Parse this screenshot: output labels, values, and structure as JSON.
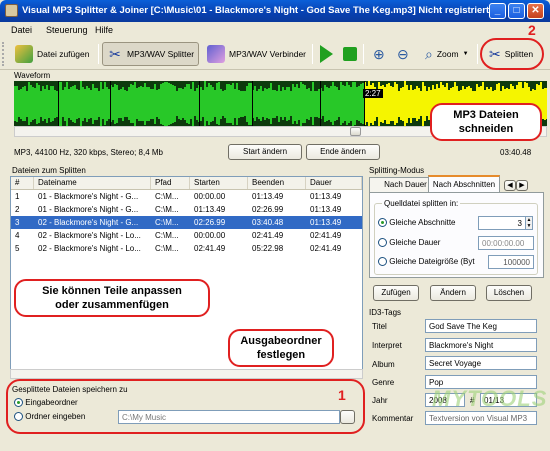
{
  "title": "Visual MP3 Splitter & Joiner [C:\\Music\\01 - Blackmore's Night - God Save The Keg.mp3] Nicht registriert",
  "menu": [
    "Datei",
    "Steuerung",
    "Hilfe"
  ],
  "toolbar": {
    "add_file": "Datei zufügen",
    "splitter": "MP3/WAV Splitter",
    "joiner": "MP3/WAV Verbinder",
    "zoom": "Zoom",
    "split": "Splitten"
  },
  "waveform": {
    "label": "Waveform",
    "marker_time": "2:27",
    "info": "MP3, 44100 Hz, 320 kbps, Stereo; 8,4 Mb",
    "start_button": "Start ändern",
    "end_button": "Ende ändern",
    "total_time": "03:40.48",
    "scroll_value": "0"
  },
  "files": {
    "label": "Dateien zum Splitten",
    "columns": [
      "#",
      "Dateiname",
      "Pfad",
      "Starten",
      "Beenden",
      "Dauer"
    ],
    "rows": [
      [
        "1",
        "01 - Blackmore's Night - G...",
        "C:\\M...",
        "00:00.00",
        "01:13.49",
        "01:13.49"
      ],
      [
        "2",
        "01 - Blackmore's Night - G...",
        "C:\\M...",
        "01:13.49",
        "02:26.99",
        "01:13.49"
      ],
      [
        "3",
        "02 - Blackmore's Night - G...",
        "C:\\M...",
        "02:26.99",
        "03:40.48",
        "01:13.49"
      ],
      [
        "4",
        "02 - Blackmore's Night - Lo...",
        "C:\\M...",
        "00:00.00",
        "02:41.49",
        "02:41.49"
      ],
      [
        "5",
        "02 - Blackmore's Night - Lo...",
        "C:\\M...",
        "02:41.49",
        "05:22.98",
        "02:41.49"
      ]
    ],
    "selected_index": 2
  },
  "splitting": {
    "label": "Splitting-Modus",
    "tabs": [
      "Nach Dauer",
      "Nach Abschnitten"
    ],
    "group_label": "Quelldatei splitten in:",
    "options": [
      "Gleiche Abschnitte",
      "Gleiche Dauer",
      "Gleiche Dateigröße (Byt"
    ],
    "equal_parts": "3",
    "equal_duration": "00:00:00.00",
    "equal_size": "100000",
    "add": "Zufügen",
    "change": "Ändern",
    "delete": "Löschen"
  },
  "id3": {
    "label": "ID3-Tags",
    "title_label": "Titel",
    "title": "God Save The Keg",
    "artist_label": "Interpret",
    "artist": "Blackmore's Night",
    "album_label": "Album",
    "album": "Secret Voyage",
    "genre_label": "Genre",
    "genre": "Pop",
    "year_label": "Jahr",
    "year": "2008",
    "track_label": "#",
    "track": "01/13",
    "comment_label": "Kommentar",
    "comment": "Textversion von Visual MP3"
  },
  "output": {
    "label": "Gesplittete Dateien speichern zu",
    "option1": "Eingabeordner",
    "option2": "Ordner eingeben",
    "path": "C:\\My Music"
  },
  "callouts": {
    "split_number": "2",
    "split_text_line1": "MP3 Dateien",
    "split_text_line2": "schneiden",
    "parts_line1": "Sie können Teile anpassen",
    "parts_line2": "oder zusammenfügen",
    "output_line1": "Ausgabeordner",
    "output_line2": "festlegen",
    "output_number": "1"
  },
  "watermark": "MYTOOLS"
}
